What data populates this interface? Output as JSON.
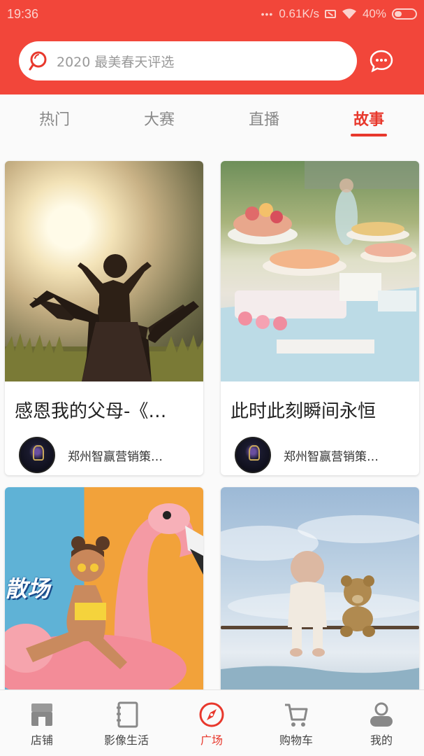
{
  "status_bar": {
    "time": "19:36",
    "network_speed": "0.61K/s",
    "battery": "40%"
  },
  "header": {
    "search_placeholder": "2020 最美春天评选",
    "icons": {
      "search": "search-icon",
      "message": "chat-bubble-icon"
    }
  },
  "tabs": [
    {
      "label": "热门",
      "active": false
    },
    {
      "label": "大赛",
      "active": false
    },
    {
      "label": "直播",
      "active": false
    },
    {
      "label": "故事",
      "active": true
    }
  ],
  "cards": [
    {
      "title": "感恩我的父母-《…",
      "author": "郑州智赢营销策…",
      "image": "father-child-sunset-photo"
    },
    {
      "title": "此时此刻瞬间永恒",
      "author": "郑州智赢营销策…",
      "image": "dessert-table-photo"
    },
    {
      "title": "",
      "author": "",
      "image": "flamingo-float-photo",
      "image_text": "散场"
    },
    {
      "title": "",
      "author": "",
      "image": "baby-teddy-bear-photo"
    }
  ],
  "bottom_nav": [
    {
      "label": "店铺",
      "icon": "store-icon",
      "active": false
    },
    {
      "label": "影像生活",
      "icon": "notebook-icon",
      "active": false
    },
    {
      "label": "广场",
      "icon": "compass-icon",
      "active": true
    },
    {
      "label": "购物车",
      "icon": "cart-icon",
      "active": false
    },
    {
      "label": "我的",
      "icon": "profile-icon",
      "active": false
    }
  ],
  "colors": {
    "brand_red": "#f2463a",
    "active_red": "#e8382c"
  }
}
